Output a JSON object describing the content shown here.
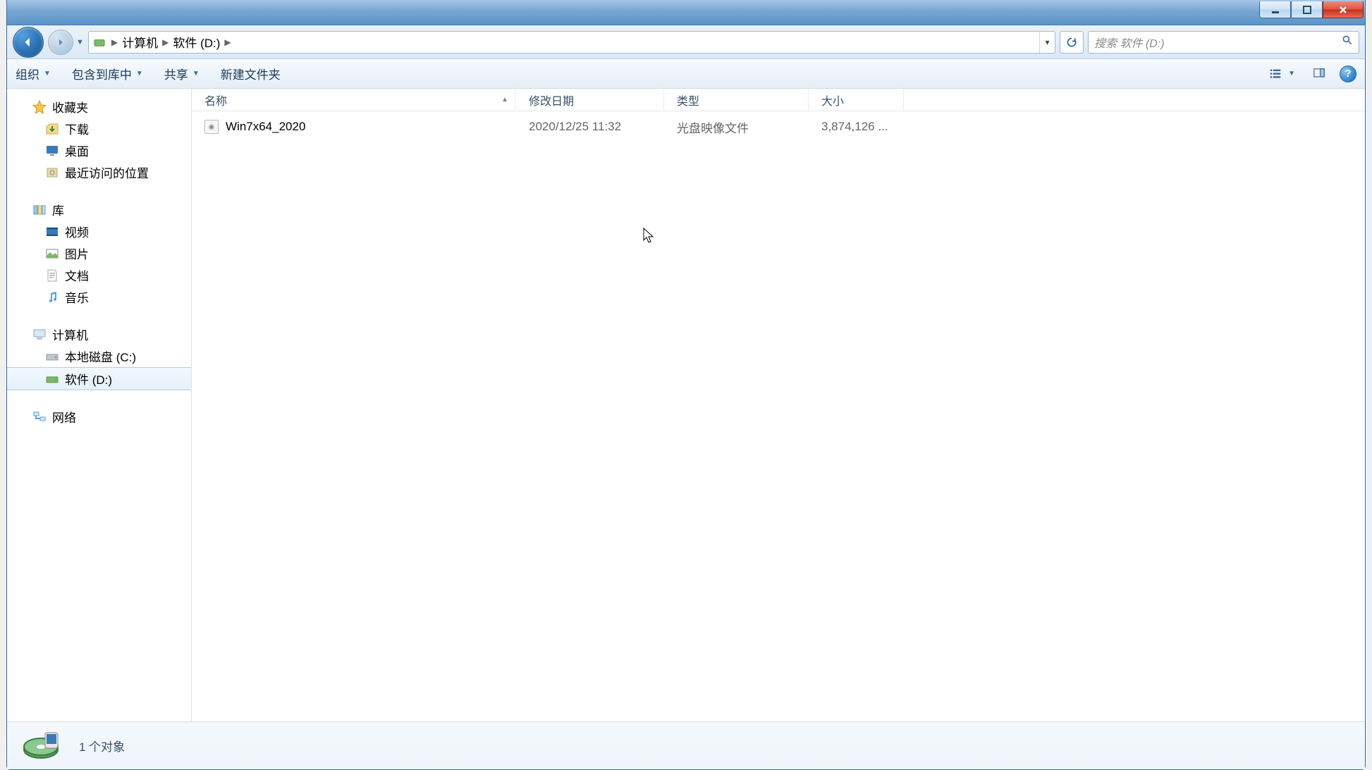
{
  "breadcrumb": {
    "item1": "计算机",
    "item2": "软件 (D:)"
  },
  "search": {
    "placeholder": "搜索 软件 (D:)"
  },
  "toolbar": {
    "organize": "组织",
    "include": "包含到库中",
    "share": "共享",
    "newfolder": "新建文件夹"
  },
  "columns": {
    "name": "名称",
    "date": "修改日期",
    "type": "类型",
    "size": "大小"
  },
  "files": [
    {
      "name": "Win7x64_2020",
      "date": "2020/12/25 11:32",
      "type": "光盘映像文件",
      "size": "3,874,126 ..."
    }
  ],
  "sidebar": {
    "favorites": "收藏夹",
    "downloads": "下载",
    "desktop": "桌面",
    "recent": "最近访问的位置",
    "libraries": "库",
    "videos": "视频",
    "pictures": "图片",
    "documents": "文档",
    "music": "音乐",
    "computer": "计算机",
    "drive_c": "本地磁盘 (C:)",
    "drive_d": "软件 (D:)",
    "network": "网络"
  },
  "status": {
    "count": "1 个对象"
  }
}
